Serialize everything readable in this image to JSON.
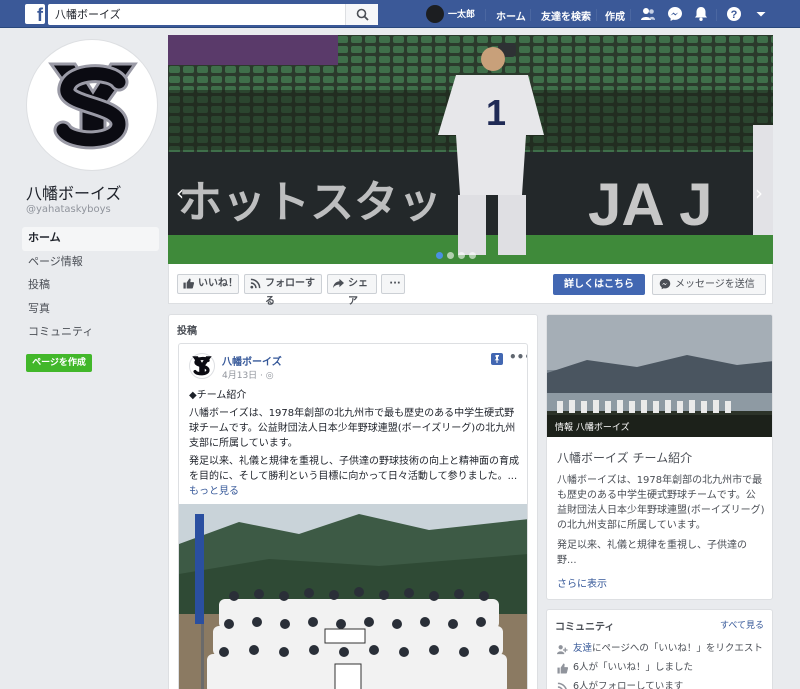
{
  "topbar": {
    "search_value": "八幡ボーイズ",
    "user_name": "一太郎",
    "links": [
      "ホーム",
      "友達を検索",
      "作成"
    ]
  },
  "page": {
    "name": "八幡ボーイズ",
    "handle": "@yahataskyboys",
    "nav": [
      "ホーム",
      "ページ情報",
      "投稿",
      "写真",
      "コミュニティ"
    ],
    "create_page": "ページを作成"
  },
  "cover": {
    "slide_count": 4,
    "active_slide": 1
  },
  "actions": {
    "like": "いいね！",
    "follow": "フォローする",
    "share": "シェア",
    "more": "···",
    "learn_more": "詳しくはこちら",
    "message": "メッセージを送信"
  },
  "posts": {
    "header": "投稿",
    "post": {
      "author": "八幡ボーイズ",
      "date": "4月13日 ·",
      "more": "•••",
      "heading": "◆チーム紹介",
      "para1": "八幡ボーイズは、1978年創部の北九州市で最も歴史のある中学生硬式野球チームです。公益財団法人日本少年野球連盟(ボーイズリーグ)の北九州支部に所属しています。",
      "para2": "発足以来、礼儀と規律を重視し、子供達の野球技術の向上と精神面の育成を目的に、そして勝利という目標に向かって日々活動して参りました。...",
      "see_more": "もっと見る"
    }
  },
  "about": {
    "caption": "情報 八幡ボーイズ",
    "title": "八幡ボーイズ チーム紹介",
    "para1": "八幡ボーイズは、1978年創部の北九州市で最も歴史のある中学生硬式野球チームです。公益財団法人日本少年野球連盟(ボーイズリーグ)の北九州支部に所属しています。",
    "para2": "発足以来、礼儀と規律を重視し、子供達の野...",
    "show_more": "さらに表示"
  },
  "community": {
    "title": "コミュニティ",
    "see_all": "すべて見る",
    "row1_link": "友達",
    "row1_text": "にページへの「いいね！」をリクエスト",
    "row2": "6人が「いいね！」しました",
    "row3": "6人がフォローしています"
  }
}
